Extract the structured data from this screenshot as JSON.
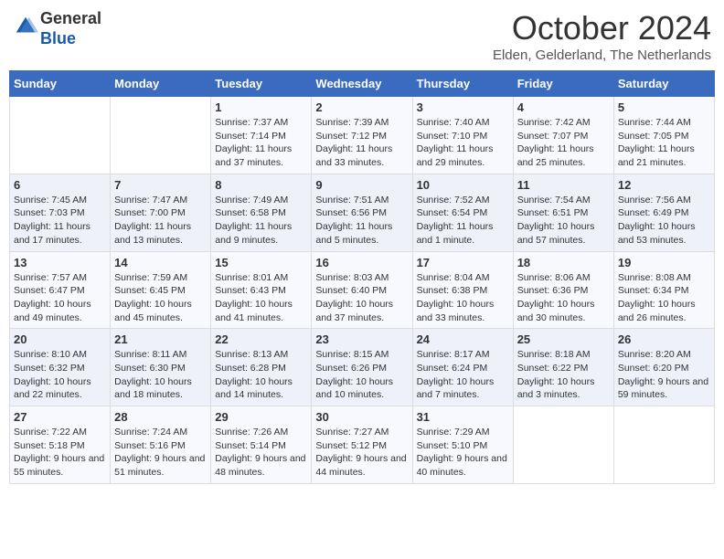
{
  "header": {
    "logo_line1": "General",
    "logo_line2": "Blue",
    "month": "October 2024",
    "location": "Elden, Gelderland, The Netherlands"
  },
  "days_of_week": [
    "Sunday",
    "Monday",
    "Tuesday",
    "Wednesday",
    "Thursday",
    "Friday",
    "Saturday"
  ],
  "weeks": [
    [
      {
        "day": "",
        "info": ""
      },
      {
        "day": "",
        "info": ""
      },
      {
        "day": "1",
        "info": "Sunrise: 7:37 AM\nSunset: 7:14 PM\nDaylight: 11 hours and 37 minutes."
      },
      {
        "day": "2",
        "info": "Sunrise: 7:39 AM\nSunset: 7:12 PM\nDaylight: 11 hours and 33 minutes."
      },
      {
        "day": "3",
        "info": "Sunrise: 7:40 AM\nSunset: 7:10 PM\nDaylight: 11 hours and 29 minutes."
      },
      {
        "day": "4",
        "info": "Sunrise: 7:42 AM\nSunset: 7:07 PM\nDaylight: 11 hours and 25 minutes."
      },
      {
        "day": "5",
        "info": "Sunrise: 7:44 AM\nSunset: 7:05 PM\nDaylight: 11 hours and 21 minutes."
      }
    ],
    [
      {
        "day": "6",
        "info": "Sunrise: 7:45 AM\nSunset: 7:03 PM\nDaylight: 11 hours and 17 minutes."
      },
      {
        "day": "7",
        "info": "Sunrise: 7:47 AM\nSunset: 7:00 PM\nDaylight: 11 hours and 13 minutes."
      },
      {
        "day": "8",
        "info": "Sunrise: 7:49 AM\nSunset: 6:58 PM\nDaylight: 11 hours and 9 minutes."
      },
      {
        "day": "9",
        "info": "Sunrise: 7:51 AM\nSunset: 6:56 PM\nDaylight: 11 hours and 5 minutes."
      },
      {
        "day": "10",
        "info": "Sunrise: 7:52 AM\nSunset: 6:54 PM\nDaylight: 11 hours and 1 minute."
      },
      {
        "day": "11",
        "info": "Sunrise: 7:54 AM\nSunset: 6:51 PM\nDaylight: 10 hours and 57 minutes."
      },
      {
        "day": "12",
        "info": "Sunrise: 7:56 AM\nSunset: 6:49 PM\nDaylight: 10 hours and 53 minutes."
      }
    ],
    [
      {
        "day": "13",
        "info": "Sunrise: 7:57 AM\nSunset: 6:47 PM\nDaylight: 10 hours and 49 minutes."
      },
      {
        "day": "14",
        "info": "Sunrise: 7:59 AM\nSunset: 6:45 PM\nDaylight: 10 hours and 45 minutes."
      },
      {
        "day": "15",
        "info": "Sunrise: 8:01 AM\nSunset: 6:43 PM\nDaylight: 10 hours and 41 minutes."
      },
      {
        "day": "16",
        "info": "Sunrise: 8:03 AM\nSunset: 6:40 PM\nDaylight: 10 hours and 37 minutes."
      },
      {
        "day": "17",
        "info": "Sunrise: 8:04 AM\nSunset: 6:38 PM\nDaylight: 10 hours and 33 minutes."
      },
      {
        "day": "18",
        "info": "Sunrise: 8:06 AM\nSunset: 6:36 PM\nDaylight: 10 hours and 30 minutes."
      },
      {
        "day": "19",
        "info": "Sunrise: 8:08 AM\nSunset: 6:34 PM\nDaylight: 10 hours and 26 minutes."
      }
    ],
    [
      {
        "day": "20",
        "info": "Sunrise: 8:10 AM\nSunset: 6:32 PM\nDaylight: 10 hours and 22 minutes."
      },
      {
        "day": "21",
        "info": "Sunrise: 8:11 AM\nSunset: 6:30 PM\nDaylight: 10 hours and 18 minutes."
      },
      {
        "day": "22",
        "info": "Sunrise: 8:13 AM\nSunset: 6:28 PM\nDaylight: 10 hours and 14 minutes."
      },
      {
        "day": "23",
        "info": "Sunrise: 8:15 AM\nSunset: 6:26 PM\nDaylight: 10 hours and 10 minutes."
      },
      {
        "day": "24",
        "info": "Sunrise: 8:17 AM\nSunset: 6:24 PM\nDaylight: 10 hours and 7 minutes."
      },
      {
        "day": "25",
        "info": "Sunrise: 8:18 AM\nSunset: 6:22 PM\nDaylight: 10 hours and 3 minutes."
      },
      {
        "day": "26",
        "info": "Sunrise: 8:20 AM\nSunset: 6:20 PM\nDaylight: 9 hours and 59 minutes."
      }
    ],
    [
      {
        "day": "27",
        "info": "Sunrise: 7:22 AM\nSunset: 5:18 PM\nDaylight: 9 hours and 55 minutes."
      },
      {
        "day": "28",
        "info": "Sunrise: 7:24 AM\nSunset: 5:16 PM\nDaylight: 9 hours and 51 minutes."
      },
      {
        "day": "29",
        "info": "Sunrise: 7:26 AM\nSunset: 5:14 PM\nDaylight: 9 hours and 48 minutes."
      },
      {
        "day": "30",
        "info": "Sunrise: 7:27 AM\nSunset: 5:12 PM\nDaylight: 9 hours and 44 minutes."
      },
      {
        "day": "31",
        "info": "Sunrise: 7:29 AM\nSunset: 5:10 PM\nDaylight: 9 hours and 40 minutes."
      },
      {
        "day": "",
        "info": ""
      },
      {
        "day": "",
        "info": ""
      }
    ]
  ]
}
